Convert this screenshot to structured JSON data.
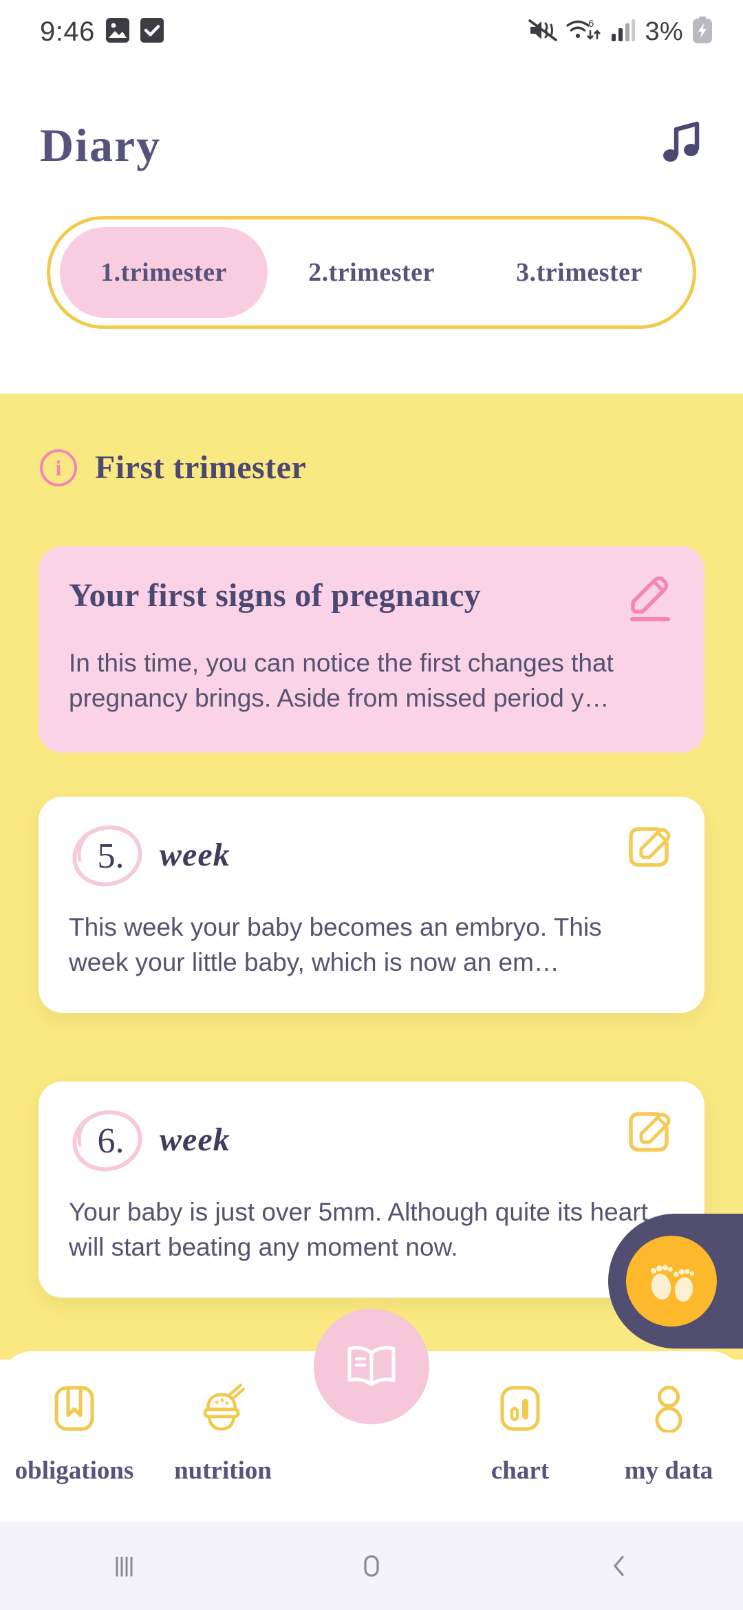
{
  "status_bar": {
    "time": "9:46",
    "battery_percent": "3%",
    "left_icons": [
      "image-icon",
      "checkbox-checked-icon"
    ],
    "right_icons": [
      "mute-vibrate-icon",
      "wifi-6-icon",
      "cellular-signal-icon",
      "battery-charging-icon"
    ]
  },
  "header": {
    "title": "Diary",
    "music_icon": "music-note-icon"
  },
  "tabs": [
    {
      "label": "1.trimester",
      "active": true
    },
    {
      "label": "2.trimester",
      "active": false
    },
    {
      "label": "3.trimester",
      "active": false
    }
  ],
  "section": {
    "info_icon": "info-circle-icon",
    "info_glyph": "i",
    "title": "First trimester"
  },
  "cards": [
    {
      "type": "pink",
      "title": "Your first signs of pregnancy",
      "body": "In this time, you can notice the first changes that pregnancy brings. Aside from missed period y…",
      "edit_icon": "pencil-underline-icon"
    },
    {
      "type": "white",
      "number": "5.",
      "week_label": "week",
      "body": "This week your baby becomes an embryo. This week your little baby, which is now an em…",
      "edit_icon": "pencil-square-icon"
    },
    {
      "type": "white",
      "number": "6.",
      "week_label": "week",
      "body": "Your baby is just over 5mm. Although quite its heart will start beating any moment now.",
      "edit_icon": "pencil-square-icon"
    }
  ],
  "fab": {
    "icon": "baby-footprints-icon"
  },
  "bottom_nav": [
    {
      "label": "obligations",
      "icon": "bookmark-icon"
    },
    {
      "label": "nutrition",
      "icon": "food-bowl-icon"
    },
    {
      "label": "",
      "icon": "open-book-icon",
      "center": true
    },
    {
      "label": "chart",
      "icon": "bar-chart-icon"
    },
    {
      "label": "my data",
      "icon": "person-icon"
    }
  ],
  "android_nav": {
    "recents": "recents-icon",
    "home": "home-icon",
    "back": "back-icon"
  },
  "colors": {
    "yellow_bg": "#fae882",
    "pink_card": "#fbd3e6",
    "pink_accent": "#f485b6",
    "active_tab": "#f9cde0",
    "tab_border": "#f2cb4e",
    "text_dark": "#56537c",
    "icon_yellow": "#f2c94c",
    "fab_dark": "#514e72",
    "fab_amber": "#fcb92c"
  }
}
